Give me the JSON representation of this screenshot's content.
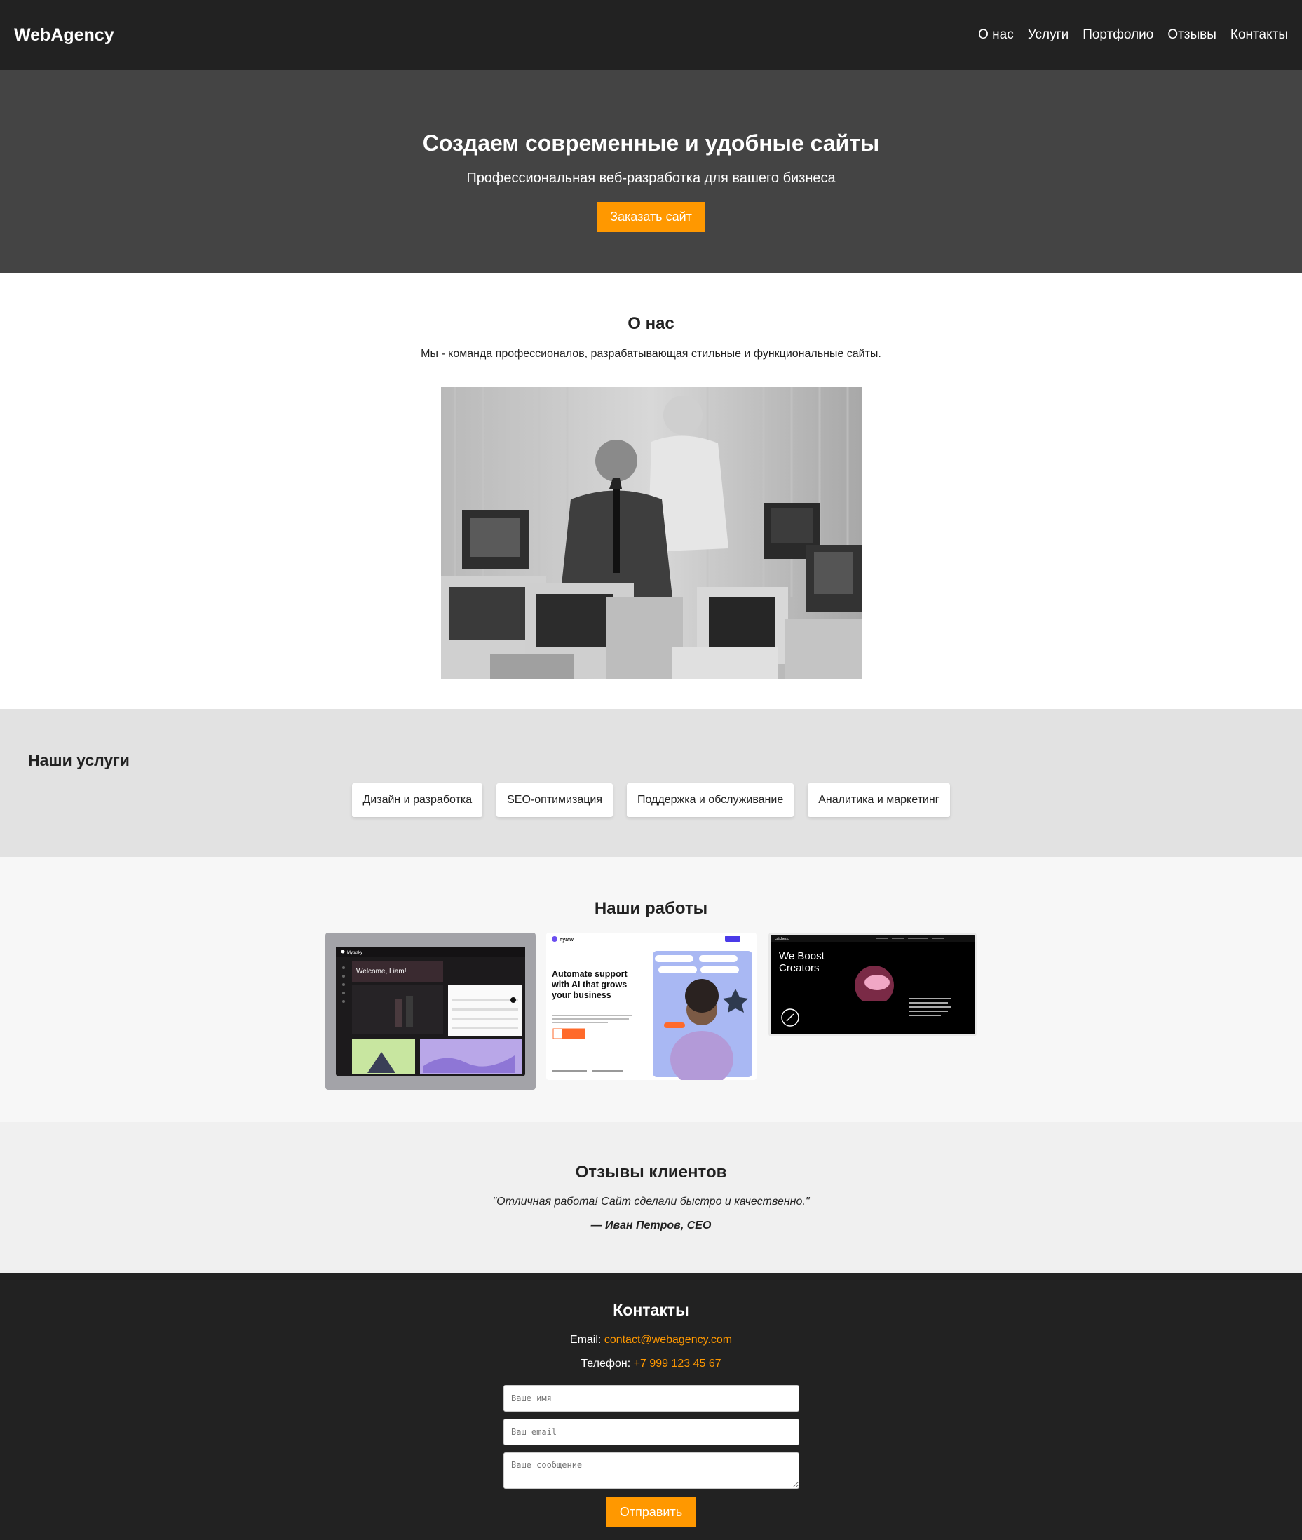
{
  "header": {
    "logo": "WebAgency",
    "nav": [
      "О нас",
      "Услуги",
      "Портфолио",
      "Отзывы",
      "Контакты"
    ]
  },
  "hero": {
    "title": "Создаем современные и удобные сайты",
    "subtitle": "Профессиональная веб-разработка для вашего бизнеса",
    "cta_label": "Заказать сайт"
  },
  "about": {
    "title": "О нас",
    "text": "Мы - команда профессионалов, разрабатывающая стильные и функциональные сайты."
  },
  "services": {
    "title": "Наши услуги",
    "items": [
      "Дизайн и разработка",
      "SEO-оптимизация",
      "Поддержка и обслуживание",
      "Аналитика и маркетинг"
    ]
  },
  "portfolio": {
    "title": "Наши работы",
    "work1": {
      "brand": "Mytasky",
      "heading": "Welcome, Liam!"
    },
    "work2": {
      "brand": "nyatw",
      "heading": "Automate support with AI that grows your business"
    },
    "work3": {
      "brand": "catchers.",
      "heading": "We Boost _ Creators"
    }
  },
  "reviews": {
    "title": "Отзывы клиентов",
    "quote": "\"Отличная работа! Сайт сделали быстро и качественно.\"",
    "author": "— Иван Петров, CEO"
  },
  "contacts": {
    "title": "Контакты",
    "email_label": "Email: ",
    "email": "contact@webagency.com",
    "phone_label": "Телефон: ",
    "phone": "+7 999 123 45 67",
    "name_placeholder": "Ваше имя",
    "email_placeholder": "Ваш email",
    "message_placeholder": "Ваше сообщение",
    "submit_label": "Отправить"
  },
  "colors": {
    "header_bg": "#222222",
    "hero_bg": "#444444",
    "accent": "#ff9800",
    "services_bg": "#e2e2e2",
    "portfolio_bg": "#f7f7f7",
    "reviews_bg": "#f0f0f0"
  }
}
